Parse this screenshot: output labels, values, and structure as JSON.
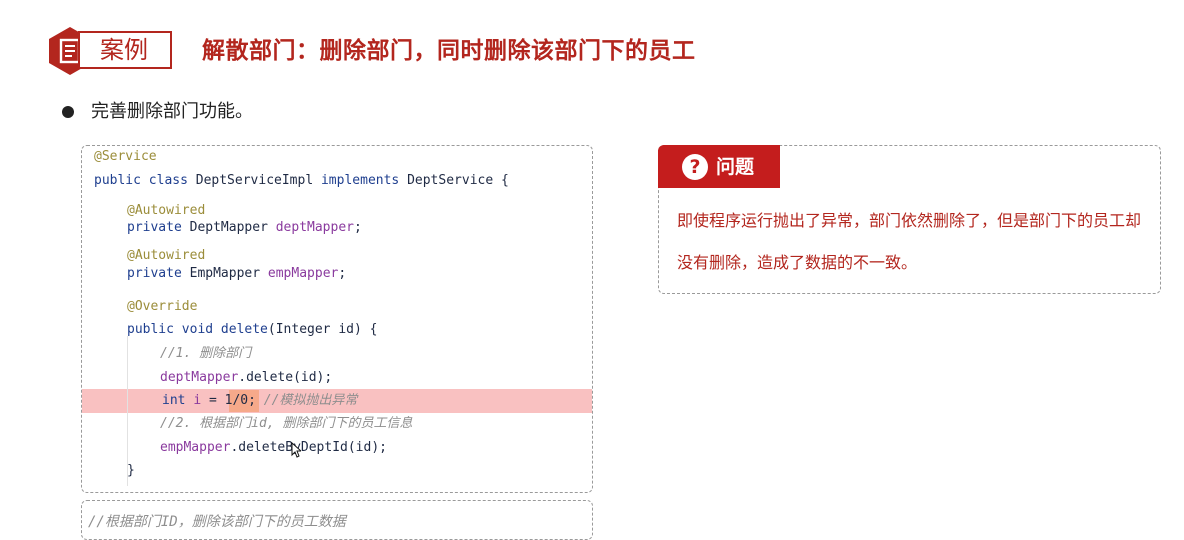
{
  "header": {
    "case_label": "案例",
    "title": "解散部门：删除部门，同时删除该部门下的员工"
  },
  "bullet": {
    "text": "完善删除部门功能。"
  },
  "code": {
    "lines": [
      {
        "t": "@Service"
      },
      {
        "a": "public class ",
        "b": "DeptServiceImpl ",
        "c": "implements ",
        "d": "DeptService {"
      },
      {
        "t": "@Autowired"
      },
      {
        "a": "private ",
        "b": "DeptMapper ",
        "c": "deptMapper",
        "d": ";"
      },
      {
        "t": "@Autowired"
      },
      {
        "a": "private ",
        "b": "EmpMapper ",
        "c": "empMapper",
        "d": ";"
      },
      {
        "t": "@Override"
      },
      {
        "a": "public void ",
        "b": "delete",
        "c": "(Integer id) {"
      },
      {
        "t": "//1. 删除部门"
      },
      {
        "a": "deptMapper",
        "b": ".delete(id);"
      },
      {
        "a": "int ",
        "b": "i ",
        "c": "= ",
        "d": "1/0",
        "e": "; ",
        "f": "//模拟抛出异常"
      },
      {
        "t": "//2. 根据部门id, 删除部门下的员工信息"
      },
      {
        "a": "empMapper",
        "b": ".deleteByDeptId(id);"
      },
      {
        "t": "}"
      }
    ],
    "next_comment": "//根据部门ID，删除该部门下的员工数据"
  },
  "problem": {
    "label": "问题",
    "q_mark": "?",
    "text": "即使程序运行抛出了异常，部门依然删除了，但是部门下的员工却没有删除，造成了数据的不一致。"
  },
  "colors": {
    "accent": "#b3261e",
    "tab": "#c41d1d",
    "highlight": "#f9c1c1"
  },
  "icons": [
    "document-hex-icon",
    "question-circle-icon",
    "mouse-cursor-icon"
  ]
}
